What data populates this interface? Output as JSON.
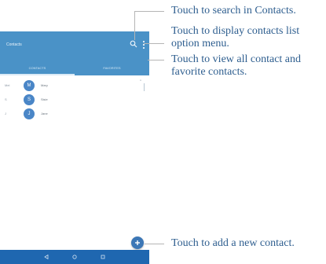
{
  "phone": {
    "app_bar": {
      "title": "Contacts",
      "color": "#4a92c7"
    },
    "icons": {
      "search": "search-icon",
      "more": "more-vert-icon"
    },
    "tabs": [
      {
        "label": "CONTACTS",
        "selected": true
      },
      {
        "label": "FAVORITES",
        "selected": false
      }
    ],
    "index_marker": "A",
    "contacts": [
      {
        "letter": "Mel",
        "avatar": "M",
        "name": "Mary"
      },
      {
        "letter": "S",
        "avatar": "S",
        "name": "Sisie"
      },
      {
        "letter": "J",
        "avatar": "J",
        "name": "Jane"
      }
    ],
    "fab_icon": "add-contact-icon",
    "nav_icons": [
      "back-icon",
      "home-icon",
      "recents-icon"
    ]
  },
  "callouts": {
    "search": "Touch to search in Contacts.",
    "menu_line1": "Touch to display contacts list",
    "menu_line2": "option menu.",
    "tabs_line1": "Touch to view all contact and",
    "tabs_line2": "favorite contacts.",
    "add": "Touch to add a new contact."
  },
  "colors": {
    "accent": "#4a92c7",
    "nav_bar": "#1f67b0",
    "callout_text": "#2e5e8f",
    "callout_line": "#b5b5b5"
  }
}
